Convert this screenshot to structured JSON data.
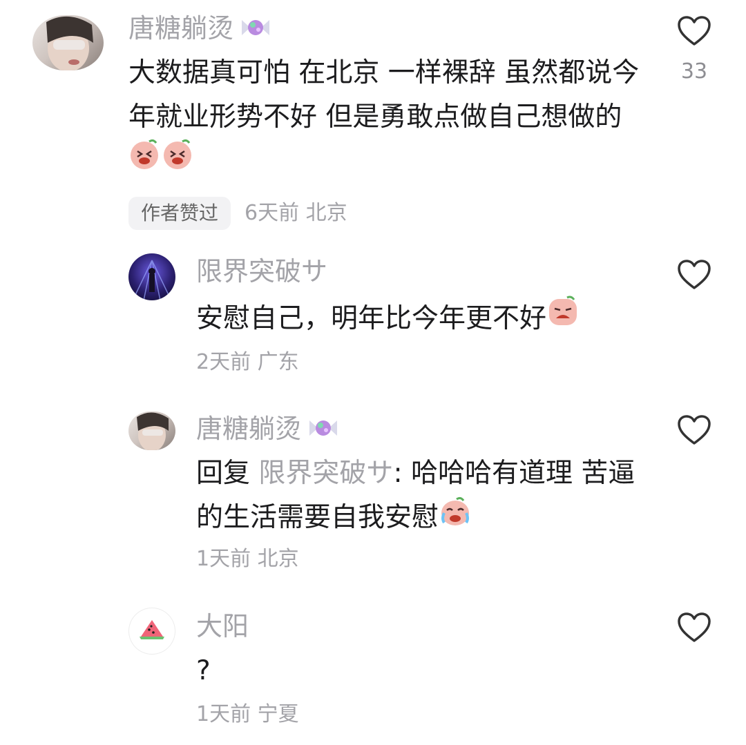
{
  "comments": [
    {
      "username": "唐糖躺烫",
      "text": "大数据真可怕 在北京 一样裸辞 虽然都说今年就业形势不好 但是勇敢点做自己想做的",
      "badge": "作者赞过",
      "time": "6天前",
      "location": "北京",
      "like_count": "33",
      "name_icon": "candy-icon",
      "emoji": "laughing-emoji-icon"
    },
    {
      "username": "限界突破サ",
      "text": "安慰自己，明年比今年更不好",
      "time": "2天前",
      "location": "广东",
      "emoji": "crying-emoji-icon"
    },
    {
      "username": "唐糖躺烫",
      "reply_prefix": "回复",
      "reply_target": "限界突破サ",
      "text": ": 哈哈哈有道理 苦逼的生活需要自我安慰",
      "time": "1天前",
      "location": "北京",
      "name_icon": "candy-icon",
      "emoji": "crying-laughing-emoji-icon"
    },
    {
      "username": "大阳",
      "text": "?",
      "time": "1天前",
      "location": "宁夏",
      "avatar_icon": "watermelon-icon"
    }
  ]
}
